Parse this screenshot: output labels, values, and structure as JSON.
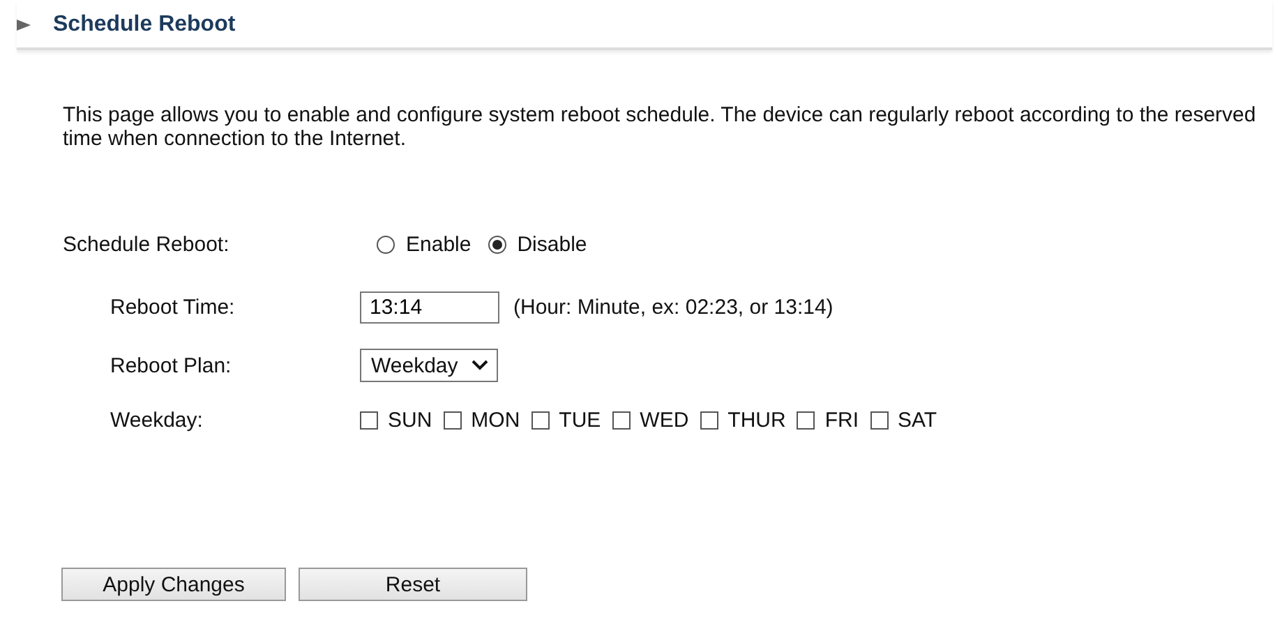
{
  "title": "Schedule Reboot",
  "description": "This page allows you to enable and configure system reboot schedule. The device can regularly reboot according to the reserved time when connection to the Internet.",
  "schedule": {
    "label": "Schedule Reboot:",
    "options": [
      {
        "label": "Enable",
        "selected": false
      },
      {
        "label": "Disable",
        "selected": true
      }
    ]
  },
  "reboot_time": {
    "label": "Reboot Time:",
    "value": "13:14",
    "hint": "(Hour: Minute, ex: 02:23, or 13:14)"
  },
  "reboot_plan": {
    "label": "Reboot Plan:",
    "value": "Weekday"
  },
  "weekday": {
    "label": "Weekday:",
    "days": [
      {
        "label": "SUN",
        "checked": false
      },
      {
        "label": "MON",
        "checked": false
      },
      {
        "label": "TUE",
        "checked": false
      },
      {
        "label": "WED",
        "checked": false
      },
      {
        "label": "THUR",
        "checked": false
      },
      {
        "label": "FRI",
        "checked": false
      },
      {
        "label": "SAT",
        "checked": false
      }
    ]
  },
  "buttons": [
    "Apply Changes",
    "Reset"
  ]
}
